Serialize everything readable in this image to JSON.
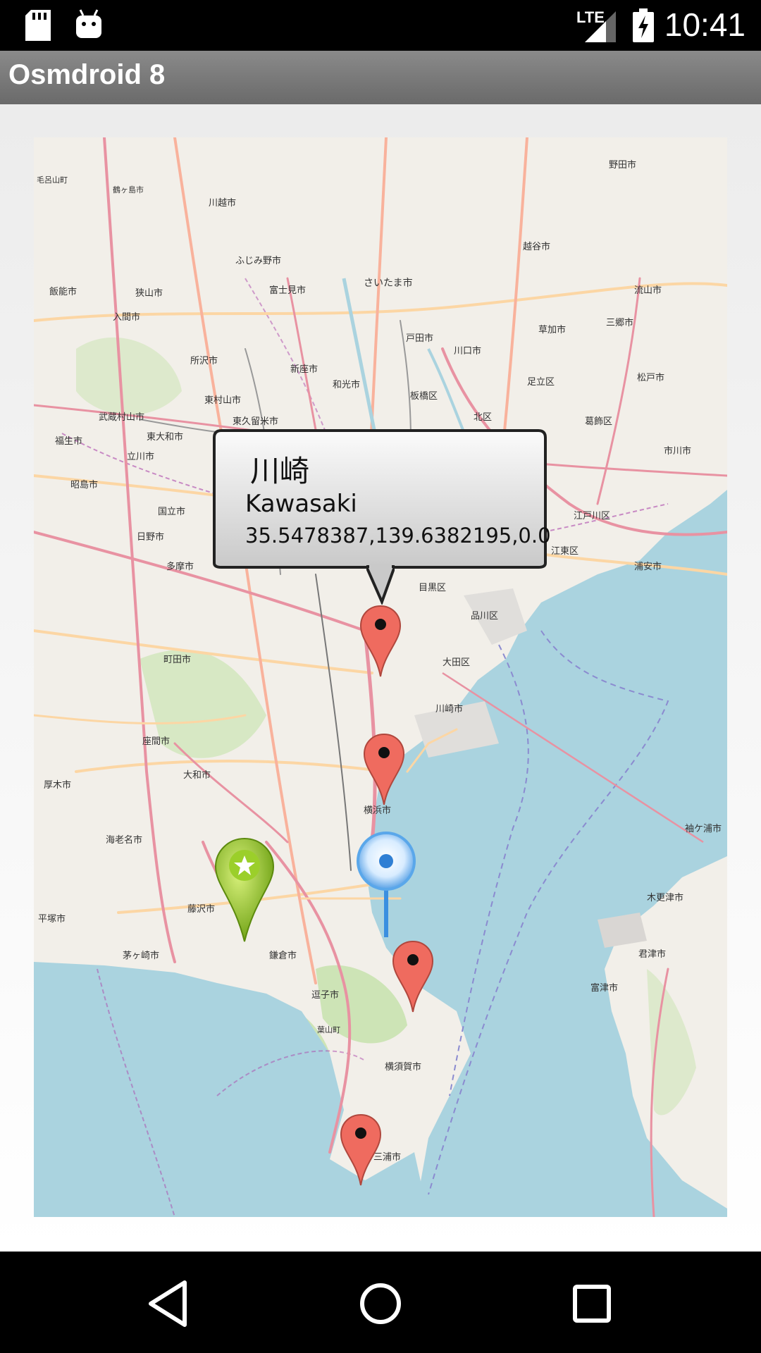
{
  "status_bar": {
    "time": "10:41",
    "network": "LTE",
    "icons": [
      "sd-card-icon",
      "android-icon",
      "signal-icon",
      "battery-charging-icon"
    ]
  },
  "app_bar": {
    "title": "Osmdroid 8"
  },
  "map": {
    "place_labels": [
      "川越市",
      "ふじみ野市",
      "富士見市",
      "さいたま市",
      "越谷市",
      "野田市",
      "狭山市",
      "入間市",
      "所沢市",
      "新座市",
      "和光市",
      "戸田市",
      "川口市",
      "草加市",
      "三郷市",
      "流山市",
      "松戸市",
      "足立区",
      "板橋区",
      "北区",
      "葛飾区",
      "東村山市",
      "東久留米市",
      "武蔵村山市",
      "東大和市",
      "立川市",
      "昭島市",
      "国立市",
      "日野市",
      "多摩市",
      "町田市",
      "目黒区",
      "品川区",
      "大田区",
      "川崎市",
      "横浜市",
      "座間市",
      "大和市",
      "海老名市",
      "藤沢市",
      "茅ヶ崎市",
      "平塚市",
      "鎌倉市",
      "逗子市",
      "横須賀市",
      "三浦市",
      "市川市",
      "浦安市",
      "江戸川区",
      "江東区",
      "木更津市",
      "君津市",
      "富津市",
      "袖ケ浦市",
      "厚木市",
      "福生市",
      "飯能市",
      "毛呂山町",
      "鶴ヶ島市",
      "葉山町"
    ],
    "popup": {
      "title": "川崎",
      "subtitle": "Kawasaki",
      "description": "35.5478387,139.6382195,0.0"
    },
    "markers": [
      "kawasaki-marker",
      "yokohama-marker",
      "yokosuka-marker",
      "miura-marker",
      "green-star-marker",
      "blue-location-marker"
    ],
    "colors": {
      "sea": "#aad3df",
      "land": "#f2efe9",
      "park": "#cde4b6",
      "road_major": "#e892a2",
      "road_trunk": "#f9b29c",
      "road_secondary": "#fcd6a4",
      "boundary": "#ac46ac"
    }
  },
  "nav_bar": {
    "back": "back-icon",
    "home": "home-icon",
    "recents": "recents-icon"
  }
}
